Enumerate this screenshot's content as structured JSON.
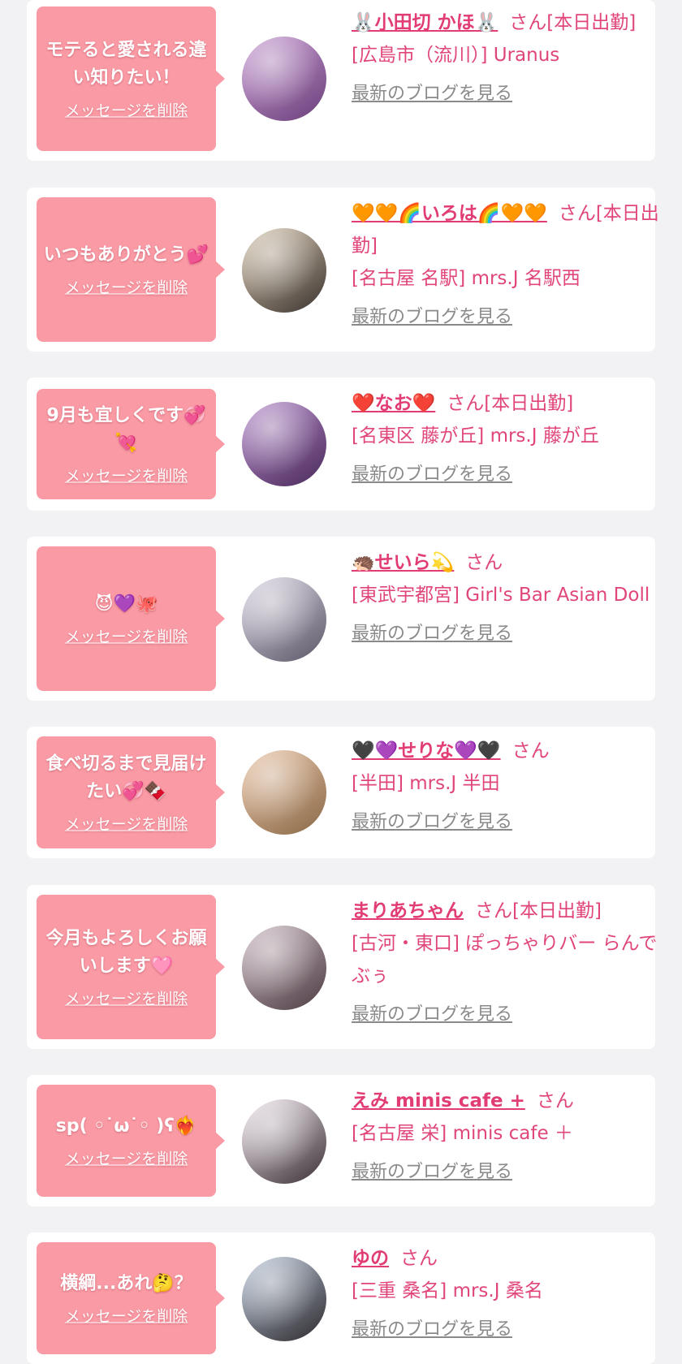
{
  "common": {
    "delete_label": "メッセージを削除",
    "blog_label": "最新のブログを見る"
  },
  "colors": {
    "page_bg": "#f2f2f4",
    "bubble": "#f99aa4",
    "accent": "#e23c74",
    "link_gray": "#8a8a8a"
  },
  "messages": [
    {
      "message": "モテると愛される違い知りたい！",
      "name": "🐰小田切 かほ🐰",
      "suffix": "さん[本日出勤]",
      "shop": "[広島市（流川）] Uranus",
      "avatar_colors": [
        "#c89cd3",
        "#6b3f7a"
      ]
    },
    {
      "message": "いつもありがとう💕",
      "name": "🧡🧡🌈いろは🌈🧡🧡",
      "suffix": "さん[本日出勤]",
      "shop": "[名古屋 名駅] mrs.J 名駅西",
      "avatar_colors": [
        "#d8c8b0",
        "#3b3430"
      ]
    },
    {
      "message": "9月も宜しくです💞💘",
      "name": "❤️なお❤️",
      "suffix": "さん[本日出勤]",
      "shop": "[名東区 藤が丘] mrs.J 藤が丘",
      "avatar_colors": [
        "#b68ccc",
        "#4a2a5a"
      ]
    },
    {
      "message": "😈💜🐙",
      "name": "🦔せいら💫",
      "suffix": "さん",
      "shop": "[東武宇都宮] Girl's Bar Asian Doll",
      "avatar_colors": [
        "#d9d3e2",
        "#5c5868"
      ]
    },
    {
      "message": "食べ切るまで見届けたい💞🍫",
      "name": "🖤💜せりな💜🖤",
      "suffix": "さん",
      "shop": "[半田] mrs.J 半田",
      "avatar_colors": [
        "#e8c2a2",
        "#8a6a4a"
      ]
    },
    {
      "message": "今月もよろしくお願いします🩷",
      "name": "まりあちゃん",
      "suffix": "さん[本日出勤]",
      "shop": "[古河・東口] ぽっちゃりバー らんでぶぅ",
      "avatar_colors": [
        "#c9b7c0",
        "#4e3e44"
      ]
    },
    {
      "message": "sp( ◦˙ω˙◦ )ʕ❤️‍🔥",
      "name": "えみ minis cafe +",
      "suffix": "さん",
      "shop": "[名古屋 栄] minis cafe ＋",
      "avatar_colors": [
        "#f0e6ee",
        "#3a3035"
      ]
    },
    {
      "message": "横綱...あれ🤔？",
      "name": "ゆの",
      "suffix": "さん",
      "shop": "[三重 桑名] mrs.J 桑名",
      "avatar_colors": [
        "#b8c6d8",
        "#2e2a2e"
      ]
    }
  ]
}
